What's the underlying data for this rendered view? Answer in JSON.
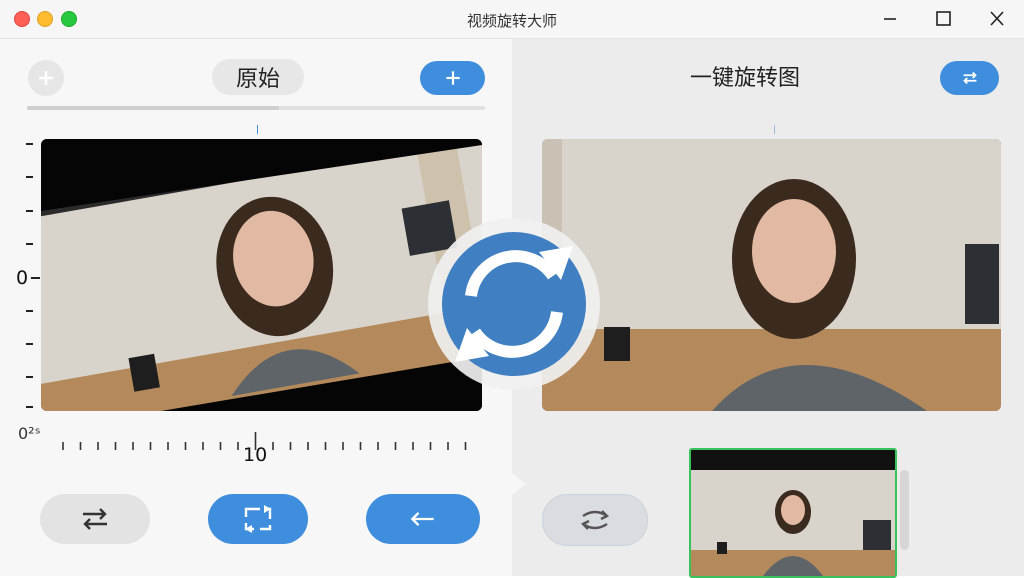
{
  "window": {
    "title": "视频旋转大师"
  },
  "left": {
    "mode_label": "原始",
    "progress_fraction": 0.55,
    "ruler": {
      "zero_label": "0",
      "start_label": "0²ˢ",
      "mid_label": "10"
    }
  },
  "right": {
    "title": "一键旋转图"
  },
  "icons": {
    "add": "plus-icon",
    "rotate": "rotate-arrows-icon",
    "swap": "swap-arrows-icon",
    "flip": "flip-frame-icon",
    "back": "arrow-left-icon"
  },
  "colors": {
    "accent": "#3f8ede",
    "thumbnail_border": "#39c25c",
    "window_bg": "#f3f3f3"
  }
}
